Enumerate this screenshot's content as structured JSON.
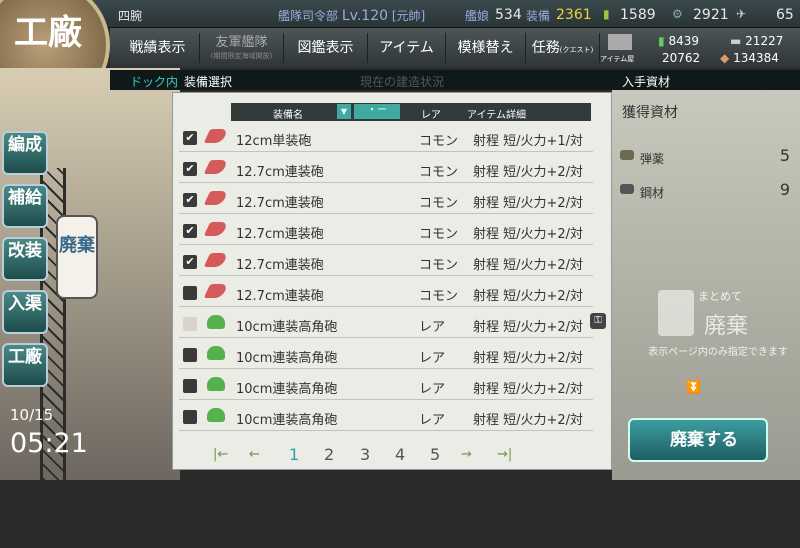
{
  "hq": {
    "level_label": "艦隊司令部",
    "level": "Lv.120",
    "rank": "[元帥]",
    "name": "四腕"
  },
  "top_stats": {
    "ships_label": "艦娘",
    "ships": "534",
    "equip_label": "装備",
    "equip": "2361",
    "bucket": "1589",
    "devmat": "2921",
    "screw": "65"
  },
  "logo": "工廠",
  "nav": [
    {
      "label": "戦績表示"
    },
    {
      "label": "友軍艦隊",
      "sub": "(期間限定海域開放)"
    },
    {
      "label": "図鑑表示"
    },
    {
      "label": "アイテム"
    },
    {
      "label": "模様替え"
    },
    {
      "label": "任務",
      "sub": "(クエスト)"
    }
  ],
  "shop_label": "アイテム屋",
  "resources": {
    "fuel": "8439",
    "steel_t": "21227",
    "ammo": "20762",
    "baux": "134384"
  },
  "breadcrumb": {
    "left": "ドック内",
    "center": "装備選択",
    "faded": "現在の建造状況",
    "right": "入手資材"
  },
  "sidebar": [
    {
      "label": "編成"
    },
    {
      "label": "補給"
    },
    {
      "label": "改装"
    },
    {
      "label": "入渠"
    },
    {
      "label": "工廠"
    }
  ],
  "arsenal_button": "廃棄",
  "datetime": {
    "date": "10/15",
    "time": "05:21"
  },
  "table": {
    "headers": {
      "name": "装備名",
      "rarity": "レア",
      "detail": "アイテム詳細"
    },
    "sort_icon": "▼",
    "sort_mode": "・ー",
    "rows": [
      {
        "checked": "✔",
        "icon": "gun",
        "name": "12cm単装砲",
        "rarity": "コモン",
        "detail": "射程 短/火力+1/対"
      },
      {
        "checked": "✔",
        "icon": "gun",
        "name": "12.7cm連装砲",
        "rarity": "コモン",
        "detail": "射程 短/火力+2/対"
      },
      {
        "checked": "✔",
        "icon": "gun",
        "name": "12.7cm連装砲",
        "rarity": "コモン",
        "detail": "射程 短/火力+2/対"
      },
      {
        "checked": "✔",
        "icon": "gun",
        "name": "12.7cm連装砲",
        "rarity": "コモン",
        "detail": "射程 短/火力+2/対"
      },
      {
        "checked": "✔",
        "icon": "gun",
        "name": "12.7cm連装砲",
        "rarity": "コモン",
        "detail": "射程 短/火力+2/対"
      },
      {
        "checked": "",
        "icon": "gun",
        "name": "12.7cm連装砲",
        "rarity": "コモン",
        "detail": "射程 短/火力+2/対"
      },
      {
        "checked": "",
        "icon": "hag",
        "name": "10cm連装高角砲",
        "rarity": "レア",
        "detail": "射程 短/火力+2/対"
      },
      {
        "checked": "",
        "icon": "hag",
        "name": "10cm連装高角砲",
        "rarity": "レア",
        "detail": "射程 短/火力+2/対"
      },
      {
        "checked": "",
        "icon": "hag",
        "name": "10cm連装高角砲",
        "rarity": "レア",
        "detail": "射程 短/火力+2/対"
      },
      {
        "checked": "",
        "icon": "hag",
        "name": "10cm連装高角砲",
        "rarity": "レア",
        "detail": "射程 短/火力+2/対"
      }
    ]
  },
  "pager": {
    "first": "|⇜",
    "prev": "⇜",
    "pages": [
      "1",
      "2",
      "3",
      "4",
      "5"
    ],
    "current": "1",
    "next": "⇝",
    "last": "⇝|"
  },
  "obtained": {
    "title": "獲得資材",
    "items": [
      {
        "name": "弾薬",
        "value": "5"
      },
      {
        "name": "鋼材",
        "value": "9"
      }
    ]
  },
  "bulk": {
    "top": "まとめて",
    "big": "廃棄",
    "sub": "表示ページ内のみ指定できます"
  },
  "discard_button": "廃棄する"
}
